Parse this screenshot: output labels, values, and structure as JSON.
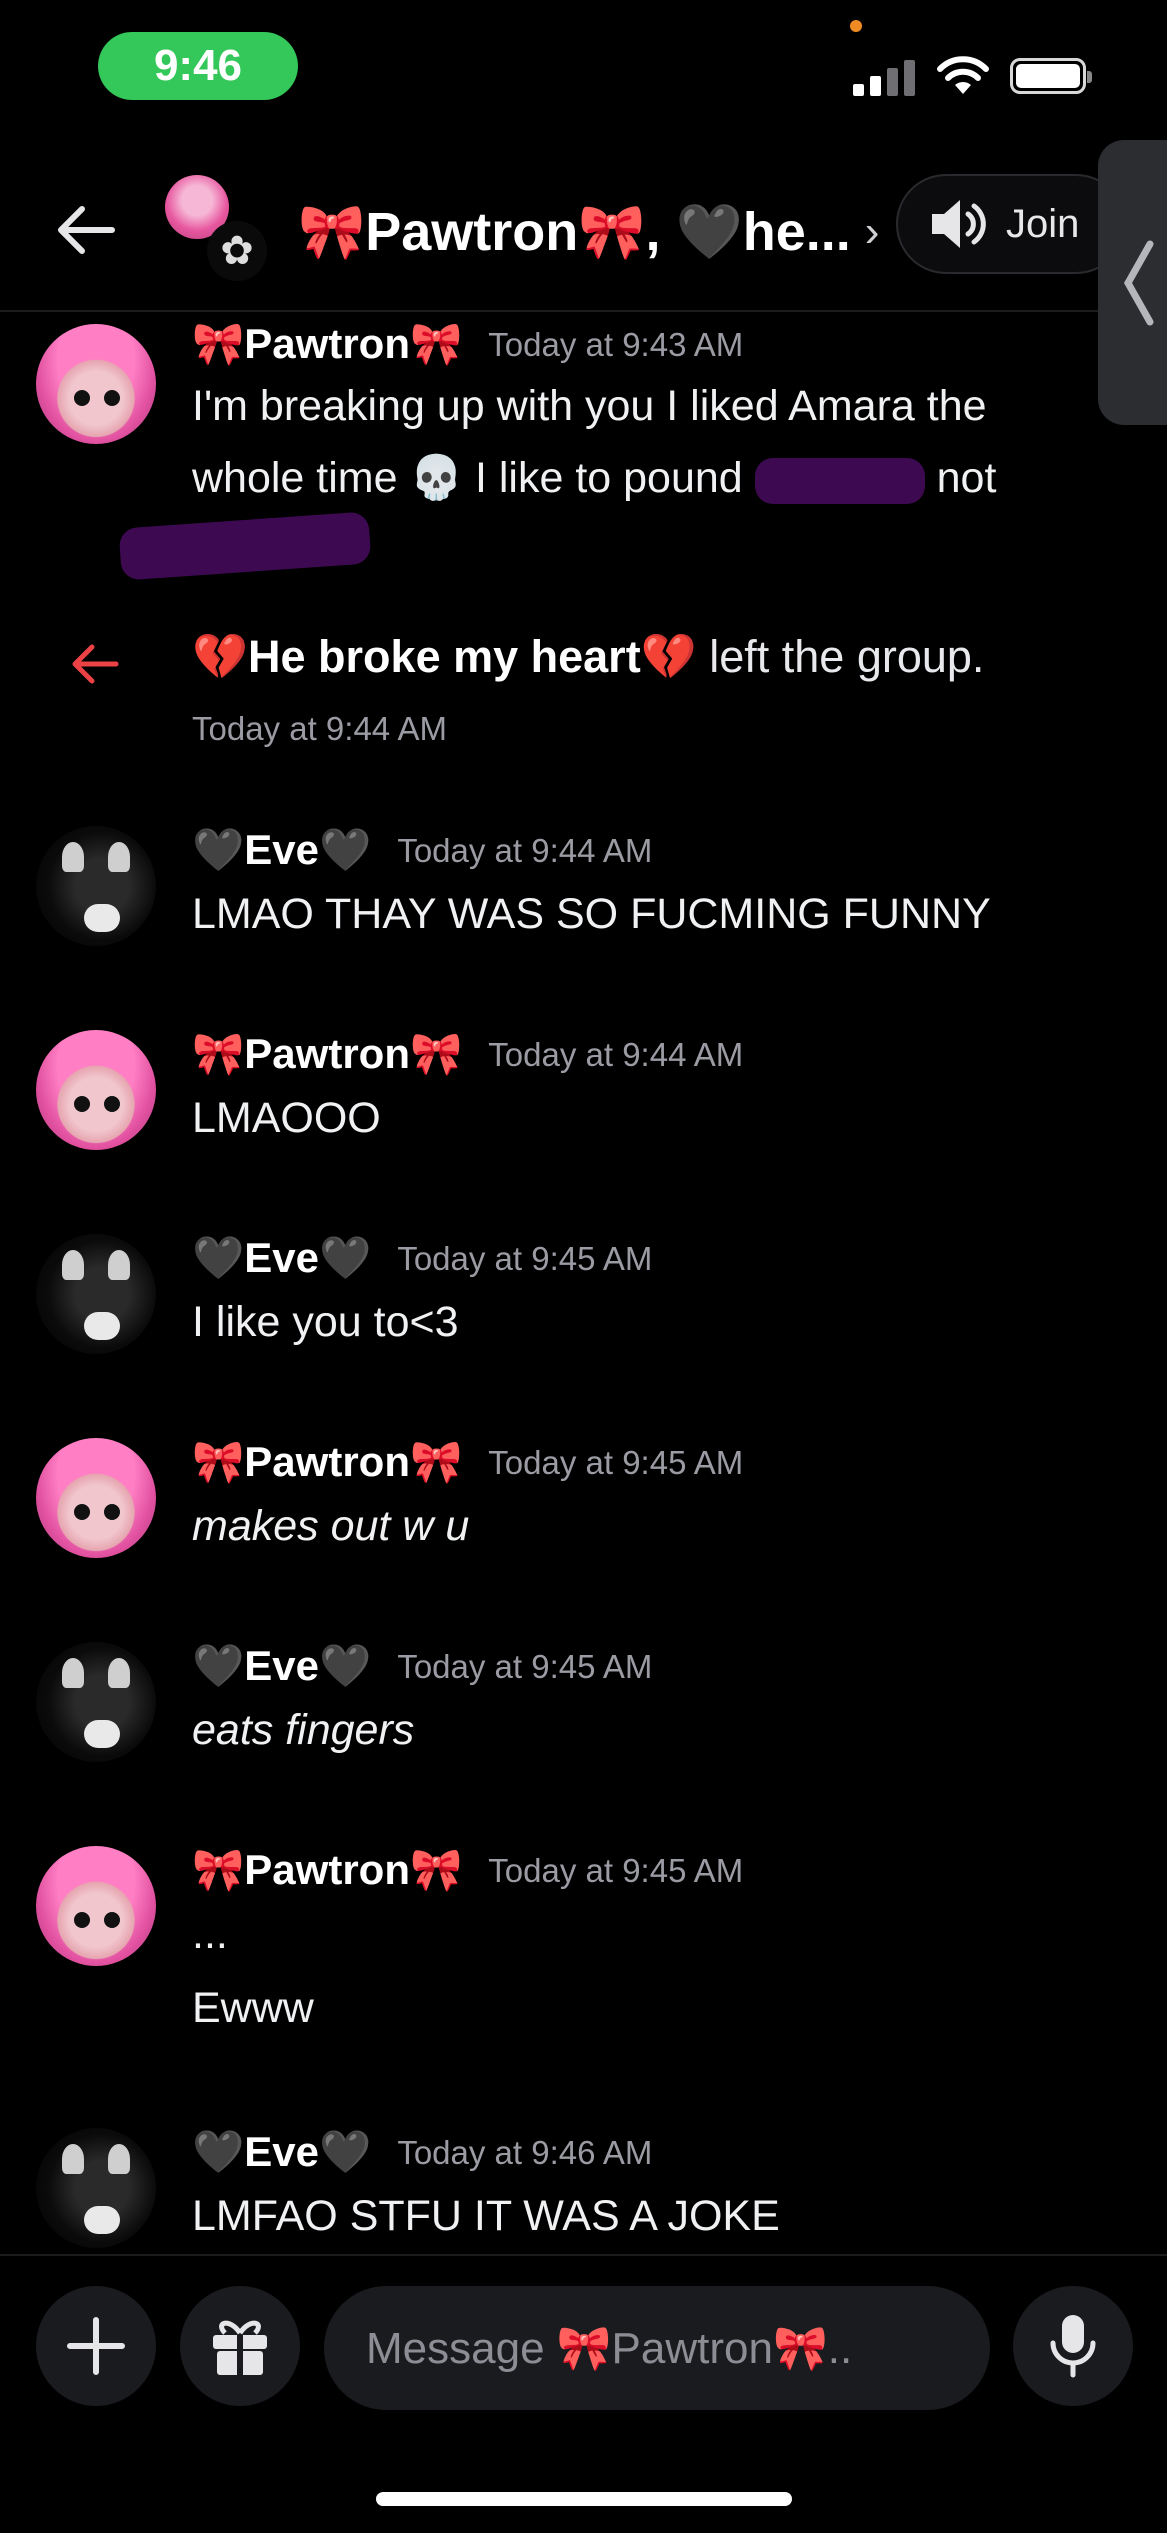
{
  "status_bar": {
    "time": "9:46"
  },
  "header": {
    "title": "🎀Pawtron🎀, 🖤he...",
    "chevron": "›",
    "join_label": "Join",
    "icons": [
      "back-arrow-icon",
      "speaker-icon",
      "chevron-left-icon"
    ]
  },
  "messages": [
    {
      "author": "🎀Pawtron🎀",
      "timestamp": "Today at 9:43 AM",
      "avatar": "pink-cat",
      "text_1": "I'm breaking up with you I liked Amara the whole time 💀 I like to pound",
      "text_2": "not"
    },
    {
      "type": "system",
      "name": "💔He broke my heart💔",
      "action": "left the group.",
      "timestamp": "Today at 9:44 AM"
    },
    {
      "author": "🖤Eve🖤",
      "timestamp": "Today at 9:44 AM",
      "avatar": "dark-cat",
      "text": "LMAO THAY WAS SO FUCMING FUNNY"
    },
    {
      "author": "🎀Pawtron🎀",
      "timestamp": "Today at 9:44 AM",
      "avatar": "pink-cat",
      "text": "LMAOOO"
    },
    {
      "author": "🖤Eve🖤",
      "timestamp": "Today at 9:45 AM",
      "avatar": "dark-cat",
      "text": "I like you to<3"
    },
    {
      "author": "🎀Pawtron🎀",
      "timestamp": "Today at 9:45 AM",
      "avatar": "pink-cat",
      "text": "makes out w u"
    },
    {
      "author": "🖤Eve🖤",
      "timestamp": "Today at 9:45 AM",
      "avatar": "dark-cat",
      "text": "eats fingers"
    },
    {
      "author": "🎀Pawtron🎀",
      "timestamp": "Today at 9:45 AM",
      "avatar": "pink-cat",
      "text_1": "...",
      "text_2": "Ewww"
    },
    {
      "author": "🖤Eve🖤",
      "timestamp": "Today at 9:46 AM",
      "avatar": "dark-cat",
      "text": "LMFAO STFU IT WAS A JOKE"
    }
  ],
  "composer": {
    "placeholder": "Message 🎀Pawtron🎀..",
    "icons": [
      "plus-icon",
      "gift-icon",
      "emoji-icon",
      "microphone-icon"
    ]
  },
  "colors": {
    "background": "#000000",
    "status_pill": "#34c759",
    "leave_arrow": "#ed4245",
    "timestamp": "#9a9ba3"
  }
}
